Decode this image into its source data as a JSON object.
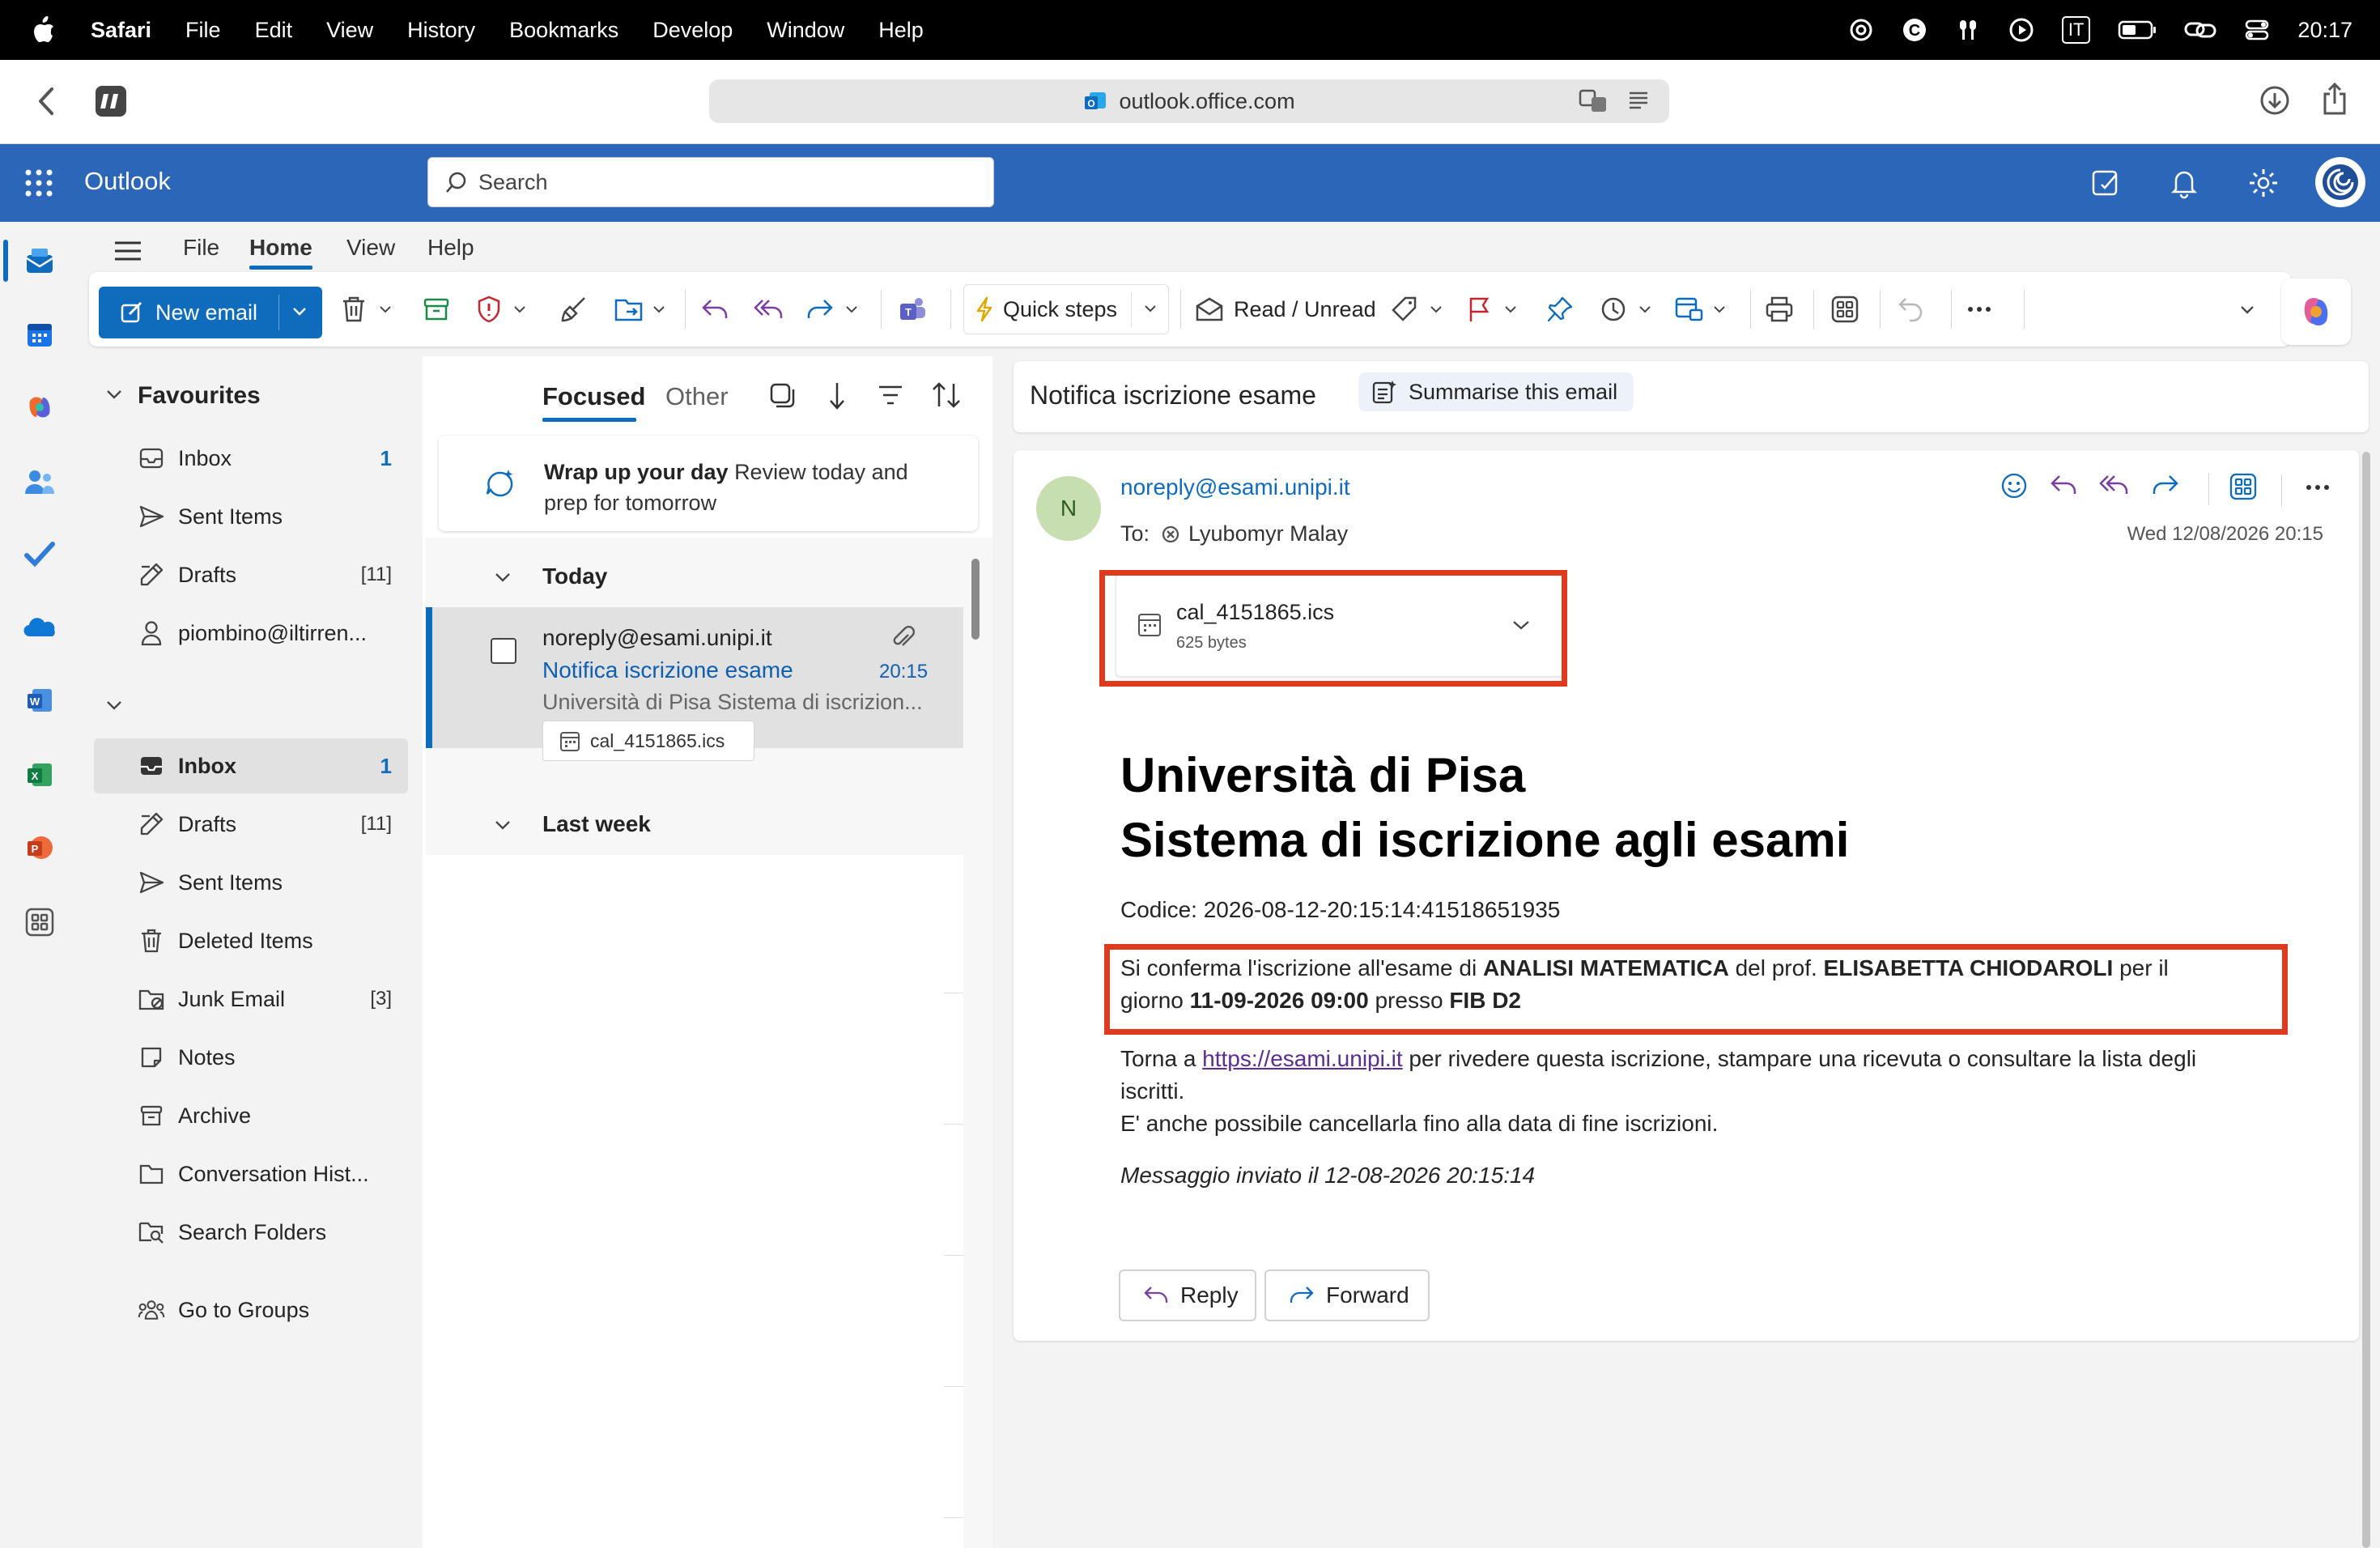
{
  "macbar": {
    "apple": "",
    "menus": [
      "Safari",
      "File",
      "Edit",
      "View",
      "History",
      "Bookmarks",
      "Develop",
      "Window",
      "Help"
    ],
    "input_indicator": "IT",
    "time": "20:17"
  },
  "safari": {
    "url": "outlook.office.com"
  },
  "outlook": {
    "app_name": "Outlook",
    "search_placeholder": "Search"
  },
  "ribbon": {
    "tabs": [
      "File",
      "Home",
      "View",
      "Help"
    ],
    "active_tab": "Home",
    "new_email": "New email",
    "quick_steps": "Quick steps",
    "read_unread": "Read / Unread"
  },
  "folders": {
    "favourites_label": "Favourites",
    "favourites": [
      {
        "label": "Inbox",
        "count": "1"
      },
      {
        "label": "Sent Items",
        "count": ""
      },
      {
        "label": "Drafts",
        "count": "[11]"
      },
      {
        "label": "piombino@iltirren...",
        "count": ""
      }
    ],
    "account": [
      {
        "label": "Inbox",
        "count": "1"
      },
      {
        "label": "Drafts",
        "count": "[11]"
      },
      {
        "label": "Sent Items",
        "count": ""
      },
      {
        "label": "Deleted Items",
        "count": ""
      },
      {
        "label": "Junk Email",
        "count": "[3]"
      },
      {
        "label": "Notes",
        "count": ""
      },
      {
        "label": "Archive",
        "count": ""
      },
      {
        "label": "Conversation Hist...",
        "count": ""
      },
      {
        "label": "Search Folders",
        "count": ""
      }
    ],
    "groups": "Go to Groups"
  },
  "msglist": {
    "focused": "Focused",
    "other": "Other",
    "wrap_title": "Wrap up your day",
    "wrap_text_1": "Review today and",
    "wrap_text_2": "prep for tomorrow",
    "today": "Today",
    "last_week": "Last week",
    "message": {
      "sender": "noreply@esami.unipi.it",
      "subject": "Notifica iscrizione esame",
      "time": "20:15",
      "preview": "Università di Pisa Sistema di iscrizion...",
      "attachment": "cal_4151865.ics"
    }
  },
  "reading": {
    "subject": "Notifica iscrizione esame",
    "summarise": "Summarise this email",
    "avatar_letter": "N",
    "from": "noreply@esami.unipi.it",
    "to_label": "To:",
    "to_name": "Lyubomyr Malay",
    "date": "Wed 12/08/2026 20:15",
    "attachment_name": "cal_4151865.ics",
    "attachment_size": "625 bytes",
    "heading1": "Università di Pisa",
    "heading2": "Sistema di iscrizione agli esami",
    "codice": "Codice: 2026-08-12-20:15:14:41518651935",
    "confirm_1": "Si conferma l'iscrizione all'esame di ",
    "course": "ANALISI MATEMATICA",
    "confirm_2": " del prof. ",
    "professor": "ELISABETTA CHIODAROLI",
    "confirm_3": " per il",
    "confirm_4": "giorno ",
    "datetime": "11-09-2026 09:00",
    "confirm_5": " presso ",
    "room": "FIB D2",
    "torna_1": "Torna a ",
    "link": "https://esami.unipi.it",
    "torna_2": " per rivedere questa iscrizione, stampare una ricevuta o consultare la lista degli",
    "torna_3": "iscritti.",
    "cancel_text": "E' anche possibile cancellarla fino alla data di fine iscrizioni.",
    "sent_text": "Messaggio inviato il 12-08-2026 20:15:14",
    "reply": "Reply",
    "forward": "Forward"
  },
  "colors": {
    "outlook_blue": "#2c66b8",
    "accent": "#0f6cbd",
    "highlight": "#e03a1e"
  }
}
